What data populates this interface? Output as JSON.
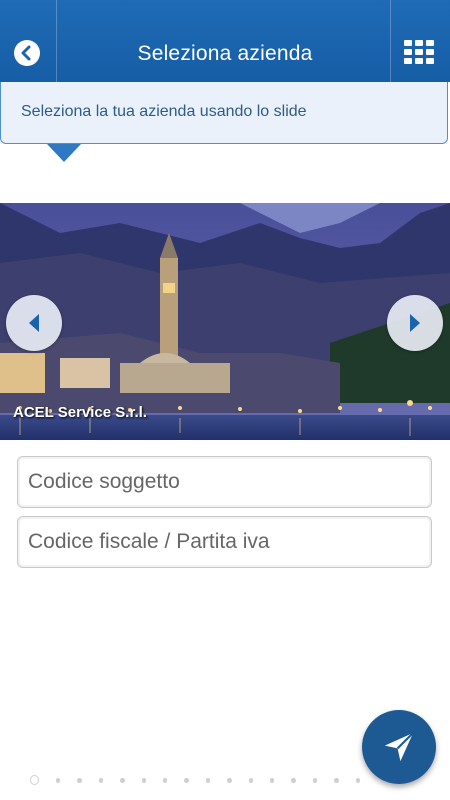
{
  "header": {
    "title": "Seleziona azienda",
    "back_icon": "back-arrow-icon",
    "menu_icon": "grid-menu-icon",
    "color": "#1a64ad"
  },
  "tooltip": {
    "text": "Seleziona la tua azienda usando lo slide"
  },
  "slider": {
    "company_name": "ACEL Service S.r.l.",
    "prev_icon": "chevron-left-icon",
    "next_icon": "chevron-right-icon"
  },
  "form": {
    "codice_soggetto_placeholder": "Codice soggetto",
    "codice_fiscale_placeholder": "Codice fiscale / Partita iva"
  },
  "fab": {
    "icon": "send-icon",
    "color": "#1d5a94"
  },
  "pagination": {
    "count": 16,
    "active_index": 0
  }
}
